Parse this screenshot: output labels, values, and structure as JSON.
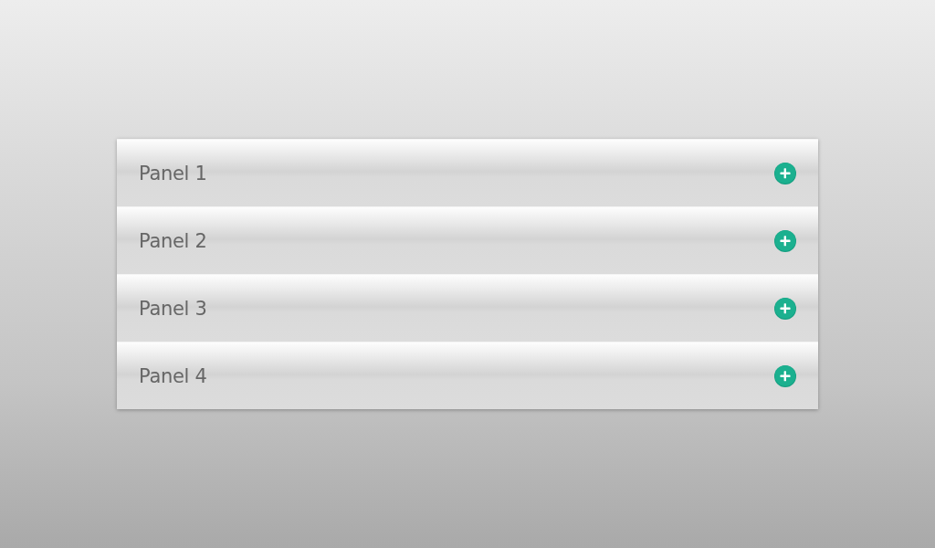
{
  "accordion": {
    "panels": [
      {
        "title": "Panel 1",
        "expanded": false
      },
      {
        "title": "Panel 2",
        "expanded": false
      },
      {
        "title": "Panel 3",
        "expanded": false
      },
      {
        "title": "Panel 4",
        "expanded": false
      }
    ]
  }
}
